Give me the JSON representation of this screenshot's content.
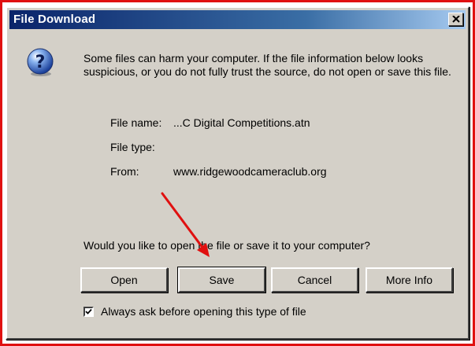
{
  "window": {
    "title": "File Download",
    "close_icon": "close-icon"
  },
  "icon": "question-icon",
  "message": "Some files can harm your computer. If the file information below looks suspicious, or you do not fully trust the source, do not open or save this file.",
  "file_info": {
    "name_label": "File name:",
    "name_value": "...C Digital Competitions.atn",
    "type_label": "File type:",
    "type_value": "",
    "from_label": "From:",
    "from_value": "www.ridgewoodcameraclub.org"
  },
  "question": "Would you like to open the file or save it to your computer?",
  "buttons": {
    "open": "Open",
    "save": "Save",
    "cancel": "Cancel",
    "more_info": "More Info"
  },
  "checkbox": {
    "label": "Always ask before opening this type of file",
    "checked": true
  },
  "colors": {
    "annotation_frame": "#e01010",
    "annotation_arrow": "#e01010",
    "titlebar": "#0a246a",
    "dialog_face": "#d4d0c8"
  }
}
